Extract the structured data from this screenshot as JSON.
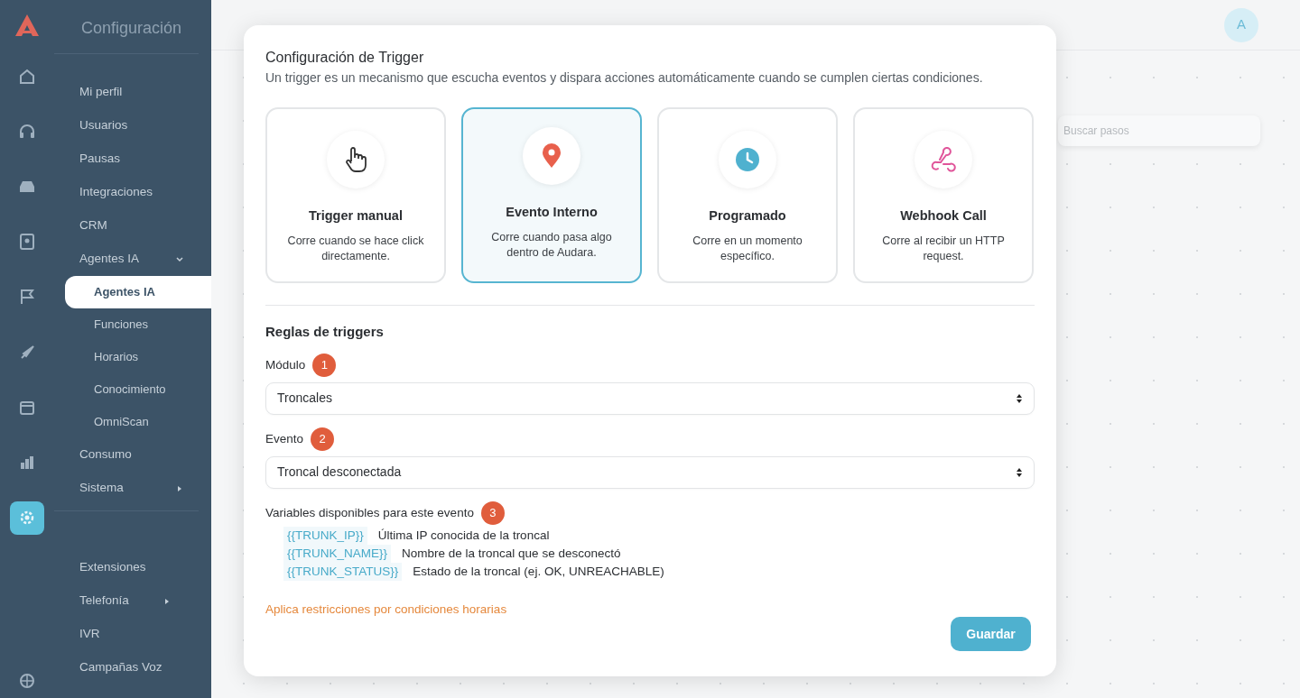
{
  "sidebar": {
    "title": "Configuración",
    "rail": [
      {
        "selected": false
      },
      {
        "selected": false
      },
      {
        "selected": false
      },
      {
        "selected": false
      },
      {
        "selected": false
      },
      {
        "selected": false
      },
      {
        "selected": false
      },
      {
        "selected": false
      },
      {
        "selected": true
      },
      {
        "selected": false
      }
    ],
    "groups": [
      {
        "items": [
          {
            "label": "Mi perfil"
          },
          {
            "label": "Usuarios"
          },
          {
            "label": "Pausas"
          },
          {
            "label": "Integraciones"
          },
          {
            "label": "CRM"
          },
          {
            "label": "Agentes IA",
            "expanded": true,
            "children": [
              {
                "label": "Agentes IA",
                "selected": true
              },
              {
                "label": "Funciones",
                "selected": false
              },
              {
                "label": "Horarios",
                "selected": false
              },
              {
                "label": "Conocimiento",
                "selected": false
              },
              {
                "label": "OmniScan",
                "selected": false
              }
            ]
          },
          {
            "label": "Consumo"
          },
          {
            "label": "Sistema",
            "expanded": false
          }
        ]
      },
      {
        "items": [
          {
            "label": "Extensiones"
          },
          {
            "label": "Telefonía",
            "expanded": false
          },
          {
            "label": "IVR"
          },
          {
            "label": "Campañas Voz"
          }
        ]
      }
    ]
  },
  "header": {
    "avatar": "A"
  },
  "canvas": {
    "search": {
      "placeholder": "Buscar pasos"
    }
  },
  "modal": {
    "title": "Configuración de Trigger",
    "description": "Un trigger es un mecanismo que escucha eventos y dispara acciones automáticamente cuando se cumplen ciertas condiciones.",
    "trigger_types": [
      {
        "kind": "manual",
        "title": "Trigger manual",
        "description": "Corre cuando se hace click directamente.",
        "selected": false
      },
      {
        "kind": "event",
        "title": "Evento Interno",
        "description": "Corre cuando pasa algo dentro de Audara.",
        "selected": true
      },
      {
        "kind": "schedule",
        "title": "Programado",
        "description": "Corre en un momento específico.",
        "selected": false
      },
      {
        "kind": "webhook",
        "title": "Webhook Call",
        "description": "Corre al recibir un HTTP request.",
        "selected": false
      }
    ],
    "rules_title": "Reglas de triggers",
    "fields": [
      {
        "label": "Módulo",
        "step": "1",
        "value": "Troncales"
      },
      {
        "label": "Evento",
        "step": "2",
        "value": "Troncal desconectada"
      }
    ],
    "variables": {
      "label": "Variables disponibles para este evento",
      "step": "3",
      "items": [
        {
          "token": "{{TRUNK_IP}}",
          "description": "Última IP conocida de la troncal"
        },
        {
          "token": "{{TRUNK_NAME}}",
          "description": "Nombre de la troncal que se desconectó"
        },
        {
          "token": "{{TRUNK_STATUS}}",
          "description": "Estado de la troncal (ej. OK, UNREACHABLE)"
        }
      ]
    },
    "schedule_link": "Aplica restricciones por condiciones horarias",
    "save_button": "Guardar"
  }
}
